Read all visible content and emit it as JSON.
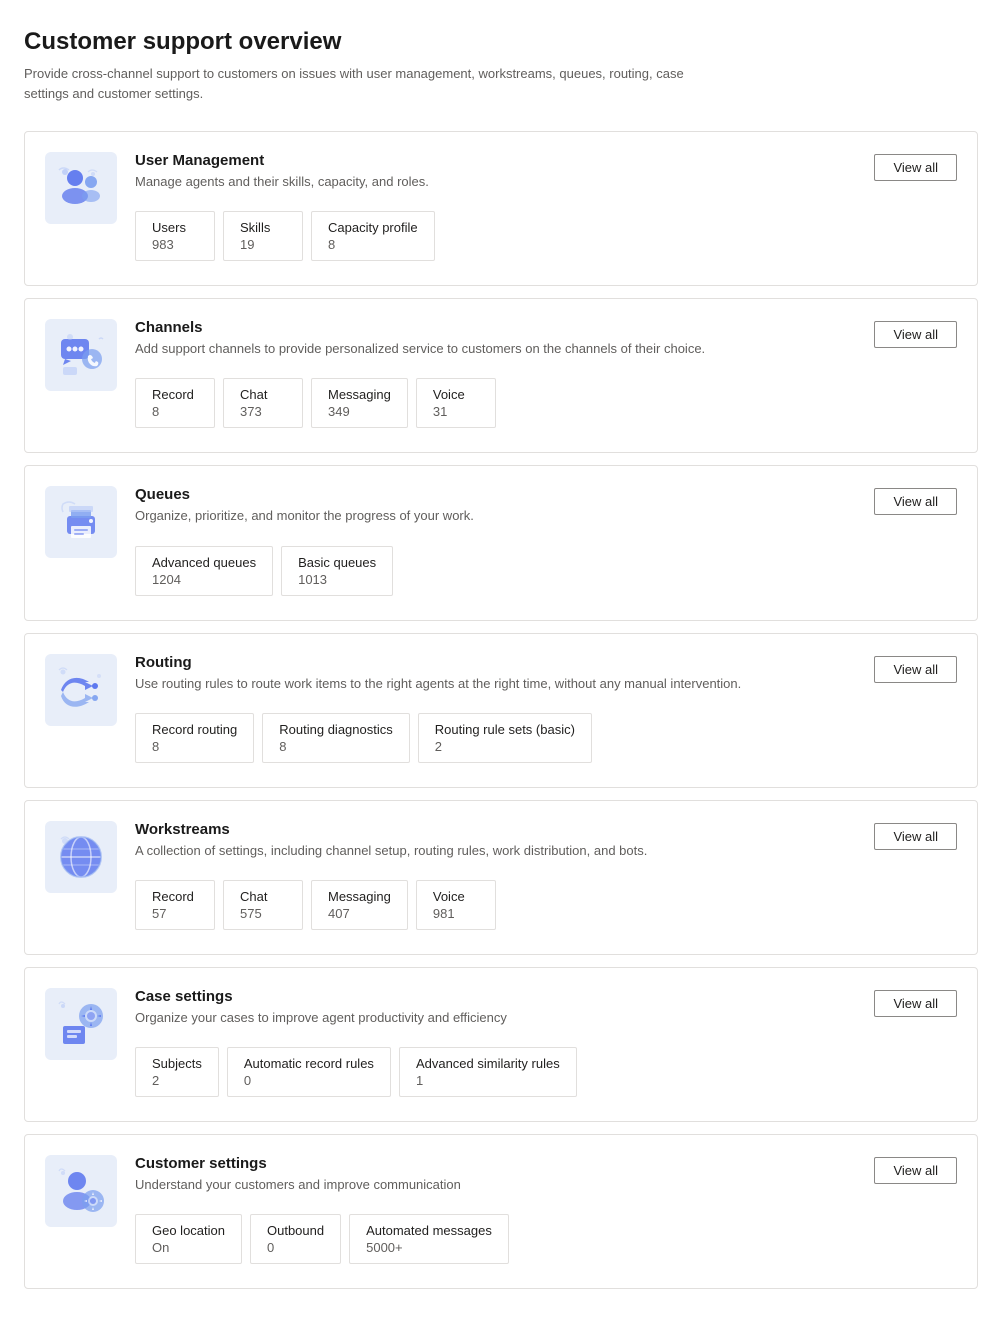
{
  "page": {
    "title": "Customer support overview",
    "subtitle": "Provide cross-channel support to customers on issues with user management, workstreams, queues, routing, case settings and customer settings."
  },
  "sections": [
    {
      "id": "user-management",
      "title": "User Management",
      "desc": "Manage agents and their skills, capacity, and roles.",
      "view_all_label": "View all",
      "stats": [
        {
          "label": "Users",
          "value": "983"
        },
        {
          "label": "Skills",
          "value": "19"
        },
        {
          "label": "Capacity profile",
          "value": "8"
        }
      ]
    },
    {
      "id": "channels",
      "title": "Channels",
      "desc": "Add support channels to provide personalized service to customers on the channels of their choice.",
      "view_all_label": "View all",
      "stats": [
        {
          "label": "Record",
          "value": "8"
        },
        {
          "label": "Chat",
          "value": "373"
        },
        {
          "label": "Messaging",
          "value": "349"
        },
        {
          "label": "Voice",
          "value": "31"
        }
      ]
    },
    {
      "id": "queues",
      "title": "Queues",
      "desc": "Organize, prioritize, and monitor the progress of your work.",
      "view_all_label": "View all",
      "stats": [
        {
          "label": "Advanced queues",
          "value": "1204"
        },
        {
          "label": "Basic queues",
          "value": "1013"
        }
      ]
    },
    {
      "id": "routing",
      "title": "Routing",
      "desc": "Use routing rules to route work items to the right agents at the right time, without any manual intervention.",
      "view_all_label": "View all",
      "stats": [
        {
          "label": "Record routing",
          "value": "8"
        },
        {
          "label": "Routing diagnostics",
          "value": "8"
        },
        {
          "label": "Routing rule sets (basic)",
          "value": "2"
        }
      ]
    },
    {
      "id": "workstreams",
      "title": "Workstreams",
      "desc": "A collection of settings, including channel setup, routing rules, work distribution, and bots.",
      "view_all_label": "View all",
      "stats": [
        {
          "label": "Record",
          "value": "57"
        },
        {
          "label": "Chat",
          "value": "575"
        },
        {
          "label": "Messaging",
          "value": "407"
        },
        {
          "label": "Voice",
          "value": "981"
        }
      ]
    },
    {
      "id": "case-settings",
      "title": "Case settings",
      "desc": "Organize your cases to improve agent productivity and efficiency",
      "view_all_label": "View all",
      "stats": [
        {
          "label": "Subjects",
          "value": "2"
        },
        {
          "label": "Automatic record rules",
          "value": "0"
        },
        {
          "label": "Advanced similarity rules",
          "value": "1"
        }
      ]
    },
    {
      "id": "customer-settings",
      "title": "Customer settings",
      "desc": "Understand your customers and improve communication",
      "view_all_label": "View all",
      "stats": [
        {
          "label": "Geo location",
          "value": "On"
        },
        {
          "label": "Outbound",
          "value": "0"
        },
        {
          "label": "Automated messages",
          "value": "5000+"
        }
      ]
    }
  ]
}
